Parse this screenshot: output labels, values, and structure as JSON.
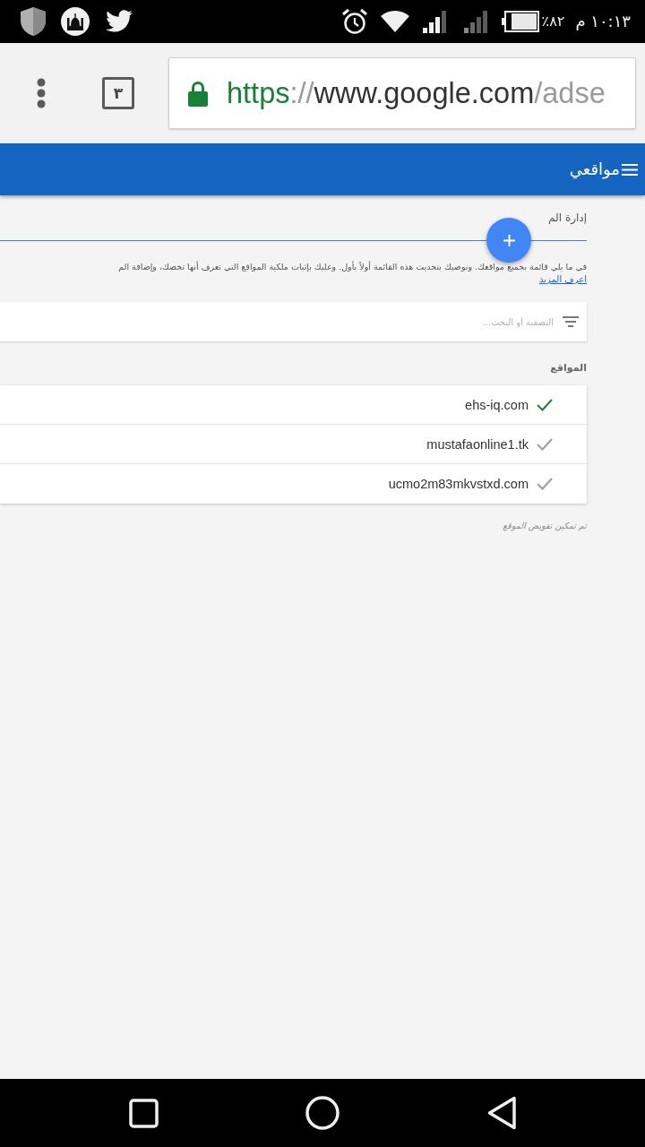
{
  "status_bar": {
    "battery_percent": "٨٢٪",
    "time": "١٠:١٣ م"
  },
  "browser_toolbar": {
    "tab_count": "٣",
    "url": {
      "scheme": "https",
      "separator": "://",
      "host": "www.google.com",
      "path": "/adse"
    }
  },
  "app_bar": {
    "title": "مواقعي"
  },
  "page": {
    "heading": "إدارة الم",
    "description": "في ما يلي قائمة بجميع مواقعك. ونوصيك بتحديث هذه القائمة أولاً بأول. وعليك بإثبات ملكية المواقع التي تعرف أنها تخصك، وإضافة الم",
    "link": "اعرف المزيد",
    "search": {
      "placeholder": "التصفية أو البحث..."
    },
    "sites_label": "المواقع",
    "sites": [
      {
        "domain": "ehs-iq.com",
        "color": "#188038"
      },
      {
        "domain": "mustafaonline1.tk",
        "color": "#9e9e9e"
      },
      {
        "domain": "ucmo2m83mkvstxd.com",
        "color": "#9e9e9e"
      }
    ],
    "footnote": "تم تمكين تفويض الموقع"
  }
}
